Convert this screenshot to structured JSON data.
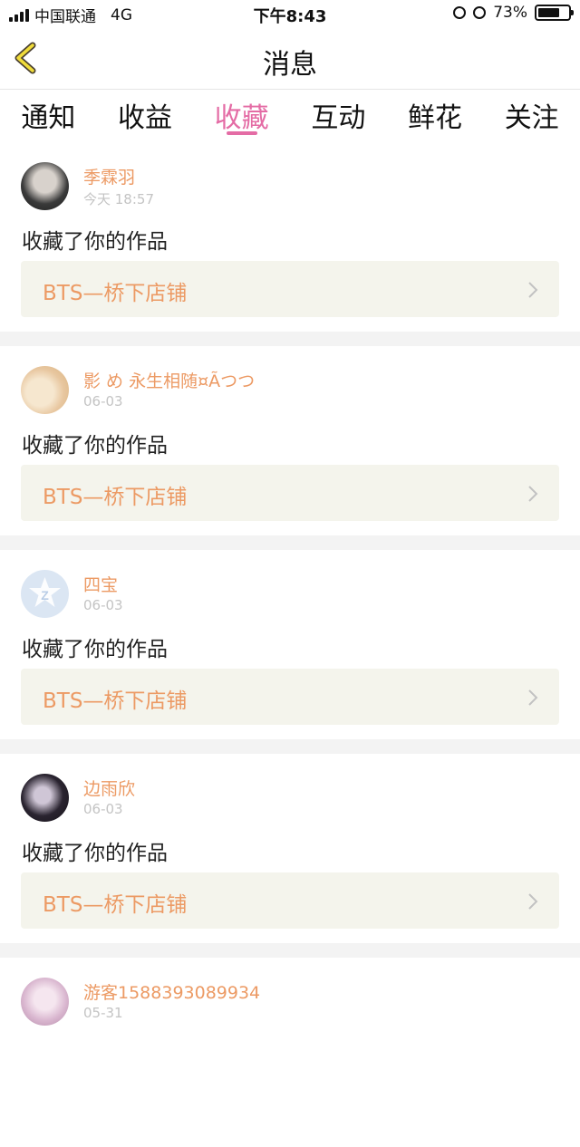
{
  "status_bar": {
    "carrier": "中国联通",
    "network": "4G",
    "time": "下午8:43",
    "battery": "73%",
    "battery_level": 0.73
  },
  "header": {
    "back_icon": "chevron-left-icon",
    "title": "消息"
  },
  "tabs": [
    {
      "label": "通知",
      "active": false
    },
    {
      "label": "收益",
      "active": false
    },
    {
      "label": "收藏",
      "active": true
    },
    {
      "label": "互动",
      "active": false
    },
    {
      "label": "鲜花",
      "active": false
    },
    {
      "label": "关注",
      "active": false
    }
  ],
  "colors": {
    "accent": "#e46ca5",
    "name": "#ec9a64",
    "link_bg": "#f4f4ec"
  },
  "messages": [
    {
      "name": "季霖羽",
      "time": "今天 18:57",
      "action": "收藏了你的作品",
      "work": "BTS—桥下店铺"
    },
    {
      "name": "影 め 永生相随¤Ãつつ",
      "time": "06-03",
      "action": "收藏了你的作品",
      "work": "BTS—桥下店铺"
    },
    {
      "name": "四宝",
      "time": "06-03",
      "action": "收藏了你的作品",
      "work": "BTS—桥下店铺"
    },
    {
      "name": "边雨欣",
      "time": "06-03",
      "action": "收藏了你的作品",
      "work": "BTS—桥下店铺"
    },
    {
      "name": "游客1588393089934",
      "time": "05-31",
      "action": "",
      "work": ""
    }
  ]
}
